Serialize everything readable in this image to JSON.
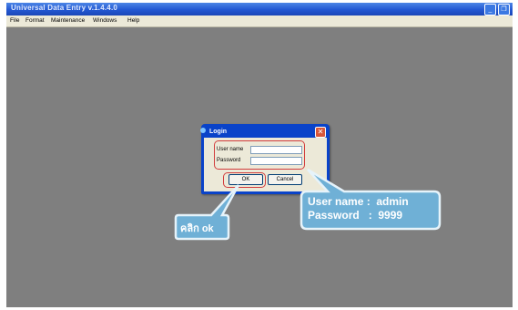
{
  "window": {
    "title": "Universal Data Entry v.1.4.4.0",
    "minimize_glyph": "_",
    "restore_glyph": "❐"
  },
  "menu": {
    "items": [
      "File",
      "Format",
      "Maintenance",
      "Windows",
      "Help"
    ]
  },
  "login_dialog": {
    "title": "Login",
    "close_glyph": "✕",
    "username_label": "User name",
    "username_value": "",
    "password_label": "Password",
    "password_value": "",
    "ok_label": "OK",
    "cancel_label": "Cancel"
  },
  "annotations": {
    "click_ok": "คลิก ok",
    "credentials_line1": "User name :  admin",
    "credentials_line2": "Password   :  9999"
  },
  "colors": {
    "desktop": "#7f7f7f",
    "highlight": "#d23c3c",
    "callout_fill": "#6fb0d6",
    "callout_border": "#e6f3fa",
    "dialog_frame": "#0a43c9"
  }
}
